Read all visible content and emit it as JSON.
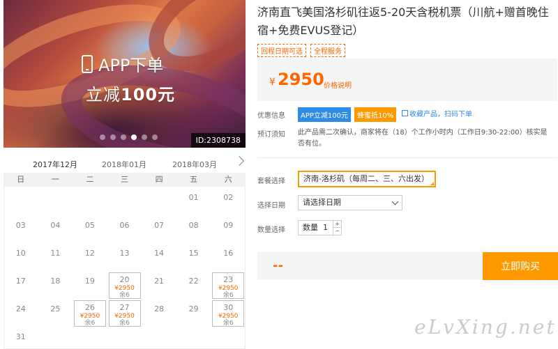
{
  "hero": {
    "promo_line1": "APP下单",
    "promo_line2_prefix": "立减",
    "promo_line2_amount": "100元",
    "id_label": "ID:2308738",
    "dot_count": 6,
    "active_dot": 3
  },
  "calendar": {
    "months": [
      "2017年12月",
      "2018年01月",
      "2018年03月"
    ],
    "active_month": 0,
    "weekdays": [
      "日",
      "一",
      "二",
      "三",
      "四",
      "五",
      "六"
    ],
    "days": [
      {
        "d": "01",
        "col": 5,
        "row": 0
      },
      {
        "d": "02",
        "col": 6,
        "row": 0
      },
      {
        "d": "03",
        "col": 0,
        "row": 1
      },
      {
        "d": "04",
        "col": 1,
        "row": 1
      },
      {
        "d": "05",
        "col": 2,
        "row": 1
      },
      {
        "d": "06",
        "col": 3,
        "row": 1
      },
      {
        "d": "07",
        "col": 4,
        "row": 1
      },
      {
        "d": "08",
        "col": 5,
        "row": 1
      },
      {
        "d": "09",
        "col": 6,
        "row": 1
      },
      {
        "d": "10",
        "col": 0,
        "row": 2
      },
      {
        "d": "11",
        "col": 1,
        "row": 2
      },
      {
        "d": "12",
        "col": 2,
        "row": 2
      },
      {
        "d": "13",
        "col": 3,
        "row": 2
      },
      {
        "d": "14",
        "col": 4,
        "row": 2
      },
      {
        "d": "15",
        "col": 5,
        "row": 2
      },
      {
        "d": "16",
        "col": 6,
        "row": 2
      },
      {
        "d": "17",
        "col": 0,
        "row": 3
      },
      {
        "d": "18",
        "col": 1,
        "row": 3
      },
      {
        "d": "19",
        "col": 2,
        "row": 3
      },
      {
        "d": "20",
        "col": 3,
        "row": 3,
        "price": "¥2950",
        "left": "余6"
      },
      {
        "d": "21",
        "col": 4,
        "row": 3
      },
      {
        "d": "22",
        "col": 5,
        "row": 3
      },
      {
        "d": "23",
        "col": 6,
        "row": 3,
        "price": "¥2950",
        "left": "余6"
      },
      {
        "d": "24",
        "col": 0,
        "row": 4
      },
      {
        "d": "25",
        "col": 1,
        "row": 4
      },
      {
        "d": "26",
        "col": 2,
        "row": 4,
        "price": "¥2950",
        "left": "余6"
      },
      {
        "d": "27",
        "col": 3,
        "row": 4,
        "price": "¥2950",
        "left": "余6"
      },
      {
        "d": "28",
        "col": 4,
        "row": 4
      },
      {
        "d": "29",
        "col": 5,
        "row": 4
      },
      {
        "d": "30",
        "col": 6,
        "row": 4,
        "price": "¥2950",
        "left": "余6"
      },
      {
        "d": "31",
        "col": 0,
        "row": 5
      }
    ]
  },
  "product": {
    "title": "济南直飞美国洛杉矶往返5-20天含税机票（川航+赠首晚住宿+免费EVUS登记）",
    "tags": [
      "回程日期可选",
      "全程服务"
    ],
    "price_symbol": "¥",
    "price": "2950",
    "price_explain": "价格说明"
  },
  "offers": {
    "label": "优惠信息",
    "app_badge": "APP立减100元",
    "honey_badge": "蜂蜜抵10%",
    "favorite": "收藏产品，扫码下单"
  },
  "booking_notice": {
    "label": "预订须知",
    "text": "此产品需二次确认，商家将在（18）个工作小时内（工作日9:30-22:00）核实是否有位。"
  },
  "form": {
    "package_label": "套餐选择",
    "package_value": "济南-洛杉矶（每周二、三、六出发）",
    "date_label": "选择日期",
    "date_value": "请选择日期",
    "qty_label": "数量选择",
    "qty_prefix": "数量",
    "qty_value": "1"
  },
  "purchase": {
    "total_placeholder": "--",
    "buy_label": "立即购买"
  },
  "watermark": "eLvXing.net",
  "colors": {
    "accent": "#ff9900",
    "price": "#ff6600",
    "link": "#2e8be6"
  }
}
